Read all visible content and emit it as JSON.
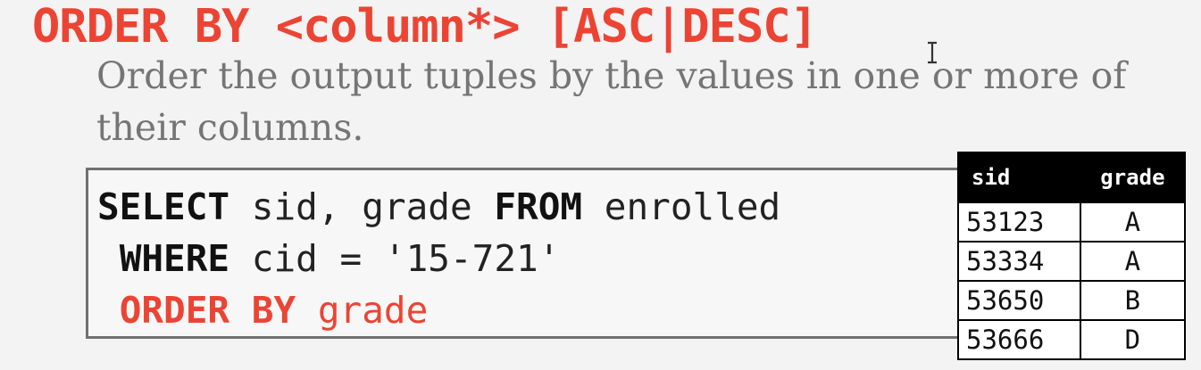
{
  "slide": {
    "heading": "ORDER BY <column*> [ASC|DESC]",
    "bullet": {
      "arrow": "→",
      "text": "Order the output tuples by the values in one or more of their columns."
    }
  },
  "code": {
    "line1": {
      "kw_select": "SELECT",
      "cols": " sid, grade ",
      "kw_from": "FROM",
      "table": " enrolled"
    },
    "line2": {
      "indent": " ",
      "kw_where": "WHERE",
      "cond": " cid = '15-721'"
    },
    "line3": {
      "indent": " ",
      "kw_order": "ORDER BY",
      "col": " grade"
    }
  },
  "result_table": {
    "headers": [
      "sid",
      "grade"
    ],
    "rows": [
      [
        "53123",
        "A"
      ],
      [
        "53334",
        "A"
      ],
      [
        "53650",
        "B"
      ],
      [
        "53666",
        "D"
      ]
    ]
  },
  "colors": {
    "accent_red": "#ec4434",
    "body_gray": "#757575",
    "table_header_bg": "#000000"
  },
  "icons": {
    "cursor": "text-cursor-icon"
  }
}
